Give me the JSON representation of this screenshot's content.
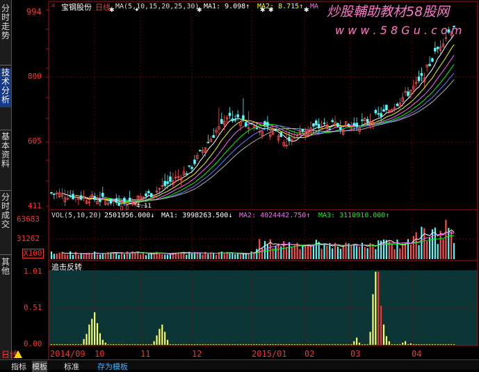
{
  "sidebar": {
    "tabs": [
      {
        "label": "分时走势",
        "active": false
      },
      {
        "label": "技术分析",
        "active": true
      },
      {
        "label": "基本资料",
        "active": false
      },
      {
        "label": "分时成交",
        "active": false
      },
      {
        "label": "其他",
        "active": false
      }
    ]
  },
  "header": {
    "stock_name": "宝钢股份",
    "period": "日线",
    "ma_label": "MA(5,10,15,20,25,30)",
    "ma1": "MA1: 9.098↑",
    "ma2": "MA2: 8.715↑",
    "ma3_partial": "MA",
    "watermark_title": "炒股輔助教材58股网",
    "watermark_url": "w w w . 5 8 G u . c o m"
  },
  "price_axis": {
    "labels": [
      "994",
      "800",
      "605",
      "411"
    ]
  },
  "price_annotations": {
    "low_marker": "4.11"
  },
  "volume_panel": {
    "label": "VOL(5,10,20)",
    "value": "2501956.000↓",
    "ma1": "MA1: 3998263.500↓",
    "ma2": "MA2: 4024442.750↑",
    "ma3": "MA3: 3110910.000↑",
    "axis_labels": [
      "63683",
      "31262",
      "X100"
    ]
  },
  "indicator_panel": {
    "label": "追击反转",
    "axis_labels": [
      "1.01",
      "0.51",
      "0.00"
    ]
  },
  "date_axis": {
    "labels": [
      "2014/09",
      "10",
      "11",
      "12",
      "2015/01",
      "02",
      "03",
      "04"
    ]
  },
  "bottom_bar": {
    "period_label": "日线",
    "tabs": [
      "指标",
      "模板",
      "标准",
      "存为模板"
    ]
  },
  "colors": {
    "axis": "#ff3232",
    "up_candle": "#ff5050",
    "down_candle": "#50ffff",
    "ma_colors": [
      "#ffffff",
      "#ffff00",
      "#ff66ff",
      "#00ff00",
      "#6a7cff",
      "#b0b0b0"
    ],
    "vol_ma1": "#ffffff",
    "vol_ma2": "#ff66ff",
    "vol_ma3": "#00ff00",
    "indicator_bar": "#ffff66",
    "indicator_bar_hi": "#ff3030"
  },
  "chart_data": {
    "type": "candlestick",
    "title": "宝钢股份 日线",
    "price_range": [
      4.11,
      9.94
    ],
    "volume_range": [
      0,
      63683
    ],
    "indicator_range": [
      0,
      1.01
    ],
    "price_anchor_points": [
      {
        "date": "2014/08",
        "close": 4.5
      },
      {
        "date": "2014/09",
        "close": 4.35
      },
      {
        "date": "2014/10",
        "close": 4.2
      },
      {
        "date": "2014/11",
        "close": 4.7
      },
      {
        "date": "2014/12",
        "close": 6.6
      },
      {
        "date": "2015/01",
        "close": 6.4
      },
      {
        "date": "2015/02",
        "close": 6.2
      },
      {
        "date": "2015/03",
        "close": 6.5
      },
      {
        "date": "2015/04",
        "close": 8.2
      }
    ],
    "indicator_peaks": [
      {
        "date": "2014/09",
        "value": 0.45
      },
      {
        "date": "2014/10",
        "value": 0.28
      },
      {
        "date": "2015/01",
        "value": 1.01
      },
      {
        "date": "2015/01",
        "value": 0.7
      }
    ]
  }
}
